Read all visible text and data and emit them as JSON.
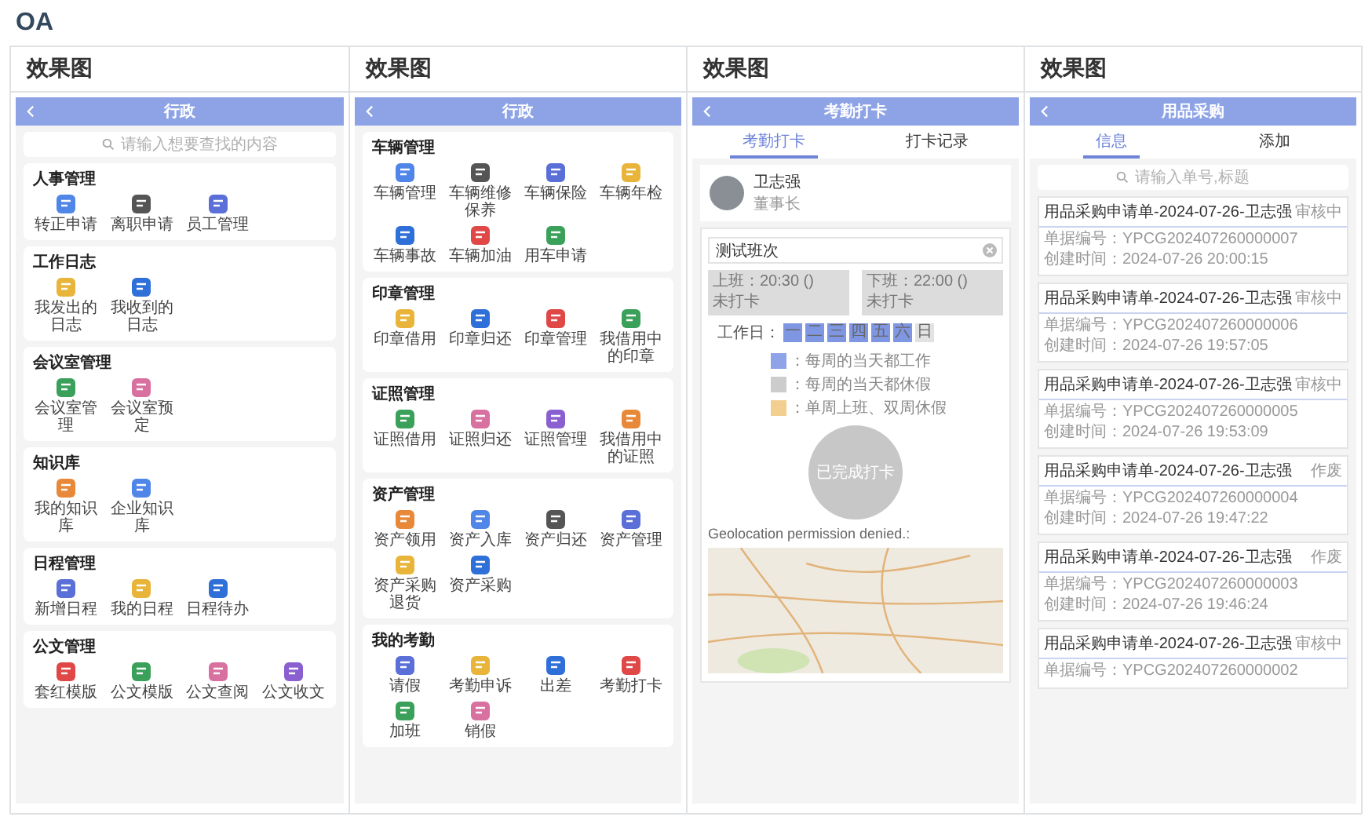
{
  "page_title": "OA",
  "columns": [
    {
      "heading": "效果图",
      "screen": {
        "kind": "menu",
        "title": "行政",
        "search": {
          "placeholder": "请输入想要查找的内容"
        },
        "sections": [
          {
            "title": "人事管理",
            "items": [
              "转正申请",
              "离职申请",
              "员工管理"
            ]
          },
          {
            "title": "工作日志",
            "items": [
              "我发出的日志",
              "我收到的日志"
            ]
          },
          {
            "title": "会议室管理",
            "items": [
              "会议室管理",
              "会议室预定"
            ]
          },
          {
            "title": "知识库",
            "items": [
              "我的知识库",
              "企业知识库"
            ]
          },
          {
            "title": "日程管理",
            "items": [
              "新增日程",
              "我的日程",
              "日程待办"
            ]
          },
          {
            "title": "公文管理",
            "items": [
              "套红模版",
              "公文模版",
              "公文查阅",
              "公文收文"
            ]
          }
        ]
      }
    },
    {
      "heading": "效果图",
      "screen": {
        "kind": "menu",
        "title": "行政",
        "sections": [
          {
            "title": "车辆管理",
            "items": [
              "车辆管理",
              "车辆维修保养",
              "车辆保险",
              "车辆年检",
              "车辆事故",
              "车辆加油",
              "用车申请"
            ]
          },
          {
            "title": "印章管理",
            "items": [
              "印章借用",
              "印章归还",
              "印章管理",
              "我借用中的印章"
            ]
          },
          {
            "title": "证照管理",
            "items": [
              "证照借用",
              "证照归还",
              "证照管理",
              "我借用中的证照"
            ]
          },
          {
            "title": "资产管理",
            "items": [
              "资产领用",
              "资产入库",
              "资产归还",
              "资产管理",
              "资产采购退货",
              "资产采购"
            ]
          },
          {
            "title": "我的考勤",
            "items": [
              "请假",
              "考勤申诉",
              "出差",
              "考勤打卡",
              "加班",
              "销假"
            ]
          }
        ]
      }
    },
    {
      "heading": "效果图",
      "screen": {
        "kind": "attendance",
        "title": "考勤打卡",
        "tabs": [
          {
            "label": "考勤打卡",
            "selected": true
          },
          {
            "label": "打卡记录",
            "selected": false
          }
        ],
        "user": {
          "name": "卫志强",
          "role": "董事长"
        },
        "shift": {
          "value": "测试班次"
        },
        "punches": [
          {
            "label": "上班：20:30 ()",
            "status": "未打卡"
          },
          {
            "label": "下班：22:00 ()",
            "status": "未打卡"
          }
        ],
        "workdays_label": "工作日：",
        "days": [
          {
            "label": "一",
            "working": true
          },
          {
            "label": "二",
            "working": true
          },
          {
            "label": "三",
            "working": true
          },
          {
            "label": "四",
            "working": true
          },
          {
            "label": "五",
            "working": true
          },
          {
            "label": "六",
            "working": true
          },
          {
            "label": "日",
            "working": false
          }
        ],
        "legend": [
          {
            "color": "#8fa4e8",
            "text": "：每周的当天都工作"
          },
          {
            "color": "#cccccc",
            "text": "：每周的当天都休假"
          },
          {
            "color": "#f2cf90",
            "text": "：单周上班、双周休假"
          }
        ],
        "punch_button": "已完成打卡",
        "geo_message": "Geolocation permission denied.:"
      }
    },
    {
      "heading": "效果图",
      "screen": {
        "kind": "list",
        "title": "用品采购",
        "tabs": [
          {
            "label": "信息",
            "selected": true
          },
          {
            "label": "添加",
            "selected": false
          }
        ],
        "search": {
          "placeholder": "请输入单号,标题"
        },
        "cards": [
          {
            "title": "用品采购申请单-2024-07-26-卫志强",
            "status": "审核中",
            "lines": [
              "单据编号：YPCG202407260000007",
              "创建时间：2024-07-26 20:00:15"
            ]
          },
          {
            "title": "用品采购申请单-2024-07-26-卫志强",
            "status": "审核中",
            "lines": [
              "单据编号：YPCG202407260000006",
              "创建时间：2024-07-26 19:57:05"
            ]
          },
          {
            "title": "用品采购申请单-2024-07-26-卫志强",
            "status": "审核中",
            "lines": [
              "单据编号：YPCG202407260000005",
              "创建时间：2024-07-26 19:53:09"
            ]
          },
          {
            "title": "用品采购申请单-2024-07-26-卫志强",
            "status": "作废",
            "lines": [
              "单据编号：YPCG202407260000004",
              "创建时间：2024-07-26 19:47:22"
            ]
          },
          {
            "title": "用品采购申请单-2024-07-26-卫志强",
            "status": "作废",
            "lines": [
              "单据编号：YPCG202407260000003",
              "创建时间：2024-07-26 19:46:24"
            ]
          },
          {
            "title": "用品采购申请单-2024-07-26-卫志强",
            "status": "审核中",
            "lines": [
              "单据编号：YPCG202407260000002"
            ]
          }
        ]
      }
    }
  ]
}
